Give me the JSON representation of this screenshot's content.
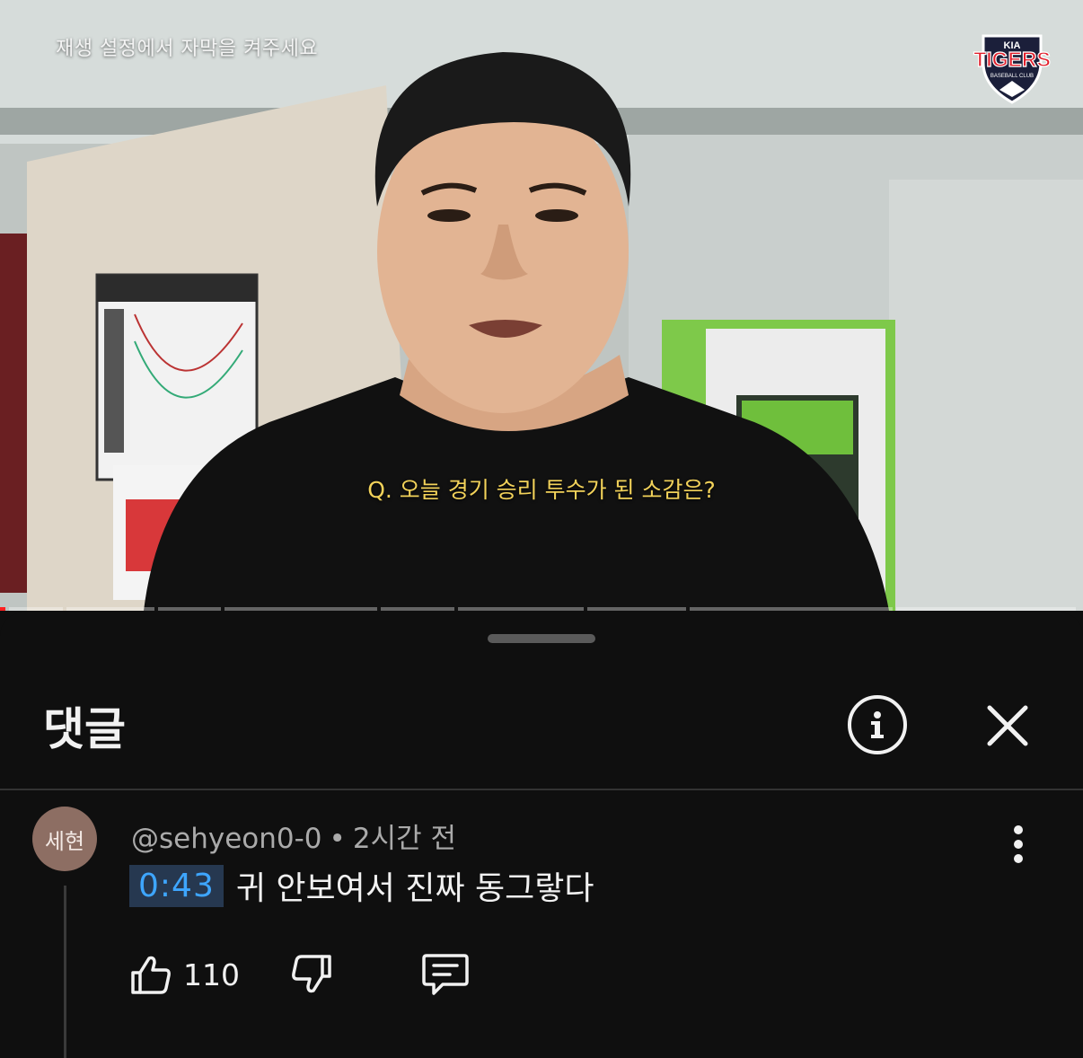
{
  "video": {
    "caption_hint": "재생 설정에서 자막을 켜주세요",
    "subtitle": "Q. 오늘 경기 승리 투수가 된 소감은?",
    "logo": {
      "brand": "KIA",
      "name": "TIGERS",
      "sub": "BASEBALL CLUB",
      "accent": "#e11d2a"
    },
    "progress_played_fraction": 0.005
  },
  "comments_sheet": {
    "title": "댓글",
    "info_icon": "info-icon",
    "close_icon": "close-icon",
    "comments": [
      {
        "avatar_text": "세현",
        "avatar_color": "#8d6e63",
        "author": "@sehyeon0-0",
        "separator": "•",
        "time": "2시간 전",
        "timestamp_link": "0:43",
        "text": "귀 안보여서 진짜 동그랗다",
        "likes": "110",
        "icons": [
          "thumbs-up-icon",
          "thumbs-down-icon",
          "reply-icon",
          "more-vert-icon"
        ]
      }
    ]
  },
  "colors": {
    "background": "#0f0f0f",
    "link": "#3ea6ff",
    "subtitle": "#f2d25a"
  }
}
